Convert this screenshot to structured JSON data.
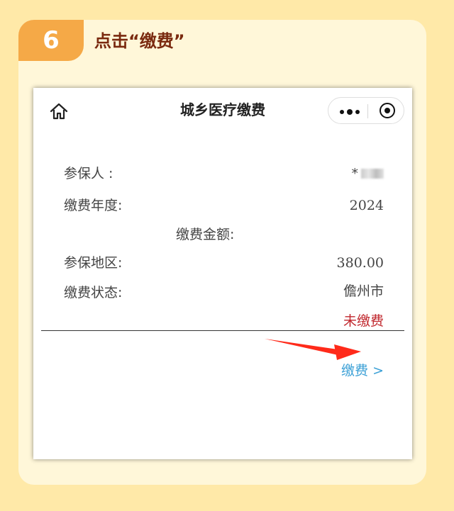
{
  "step": {
    "number": "6",
    "title": "点击“缴费”"
  },
  "nav": {
    "title": "城乡医疗缴费"
  },
  "form": {
    "insured_label": "参保人 :",
    "insured_value": "*",
    "year_label": "缴费年度:",
    "year_value": "2024",
    "amount_label": "缴费金额:",
    "region_label": "参保地区:",
    "amount_value": "380.00",
    "status_label": "缴费状态:",
    "region_value": "儋州市",
    "status_value": "未缴费"
  },
  "pay_link": "缴费 >",
  "colors": {
    "accent": "#f5a947",
    "link": "#3ba0d6",
    "warning": "#c0272d",
    "arrow": "#ff2a1a"
  }
}
